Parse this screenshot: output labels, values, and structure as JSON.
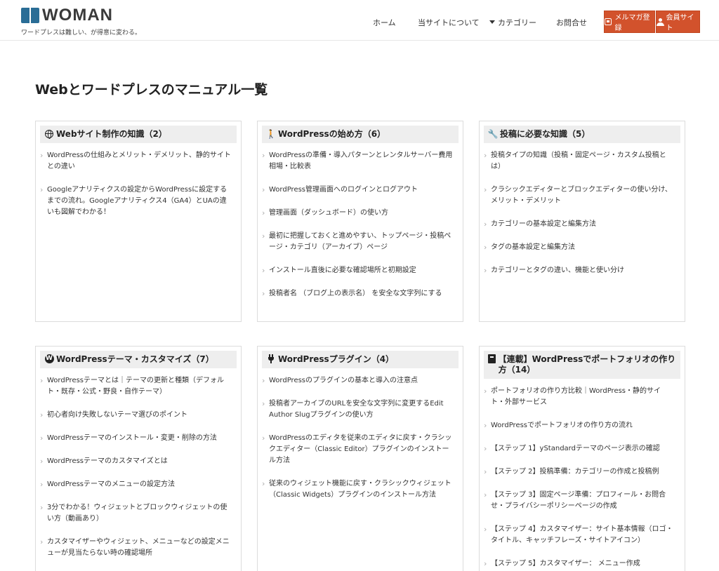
{
  "header": {
    "logo_text": "WOMAN",
    "tagline": "ワードプレスは難しい、が得意に変わる。",
    "nav": [
      {
        "label": "ホーム"
      },
      {
        "label": "当サイトについて"
      },
      {
        "label": "カテゴリー"
      },
      {
        "label": "お問合せ"
      }
    ],
    "buttons": {
      "newsletter": "メルマガ登録",
      "member": "会員サイト"
    },
    "button_color": "#d2522c"
  },
  "page": {
    "title": "Webとワードプレスのマニュアル一覧"
  },
  "cards": [
    {
      "icon": "globe-icon",
      "title": "Webサイト制作の知識（2）",
      "items": [
        "WordPressの仕組みとメリット・デメリット、静的サイトとの違い",
        "Googleアナリティクスの設定からWordPressに設定するまでの流れ。Googleアナリティクス4（GA4）とUAの違いも図解でわかる！"
      ]
    },
    {
      "icon": "walking-person-icon",
      "title": "WordPressの始め方（6）",
      "items": [
        "WordPressの準備・導入パターンとレンタルサーバー費用相場・比較表",
        "WordPress管理画面へのログインとログアウト",
        "管理画面（ダッシュボード）の使い方",
        "最初に把握しておくと進めやすい、トップページ・投稿ページ・カテゴリ（アーカイブ）ページ",
        "インストール直後に必要な確認場所と初期設定",
        "投稿者名 （ブログ上の表示名） を安全な文字列にする"
      ]
    },
    {
      "icon": "wrench-icon",
      "title": "投稿に必要な知識（5）",
      "items": [
        "投稿タイプの知識（投稿・固定ページ・カスタム投稿とは）",
        "クラシックエディターとブロックエディターの使い分け、メリット・デメリット",
        "カテゴリーの基本設定と編集方法",
        "タグの基本設定と編集方法",
        "カテゴリーとタグの違い、機能と使い分け"
      ]
    },
    {
      "icon": "wordpress-icon",
      "title": "WordPressテーマ・カスタマイズ（7）",
      "items": [
        "WordPressテーマとは｜テーマの更新と種類（デフォルト・既存・公式・野良・自作テーマ）",
        "初心者向け失敗しないテーマ選びのポイント",
        "WordPressテーマのインストール・変更・削除の方法",
        "WordPressテーマのカスタマイズとは",
        "WordPressテーマのメニューの設定方法",
        "3分でわかる！ウィジェットとブロックウィジェットの使い方（動画あり）",
        "カスタマイザーやウィジェット、メニューなどの設定メニューが見当たらない時の確認場所"
      ]
    },
    {
      "icon": "plug-icon",
      "title": "WordPressプラグイン（4）",
      "items": [
        "WordPressのプラグインの基本と導入の注意点",
        "投稿者アーカイブのURLを安全な文字列に変更するEdit Author Slugプラグインの使い方",
        "WordPressのエディタを従来のエディタに戻す・クラシックエディター（Classic Editor）プラグインのインストール方法",
        "従来のウィジェット機能に戻す・クラシックウィジェット（Classic Widgets）プラグインのインストール方法"
      ]
    },
    {
      "icon": "book-icon",
      "title": "【連載】WordPressでポートフォリオの作り方（14）",
      "items": [
        "ポートフォリオの作り方比較｜WordPress・静的サイト・外部サービス",
        "WordPressでポートフォリオの作り方の流れ",
        "【ステップ 1】yStandardテーマのページ表示の確認",
        "【ステップ 2】投稿準備：カテゴリーの作成と投稿例",
        "【ステップ 3】固定ページ準備：プロフィール・お問合せ・プライバシーポリシーページの作成",
        "【ステップ 4】カスタマイザー：サイト基本情報（ロゴ・タイトル、キャッチフレーズ・サイトアイコン）",
        "【ステップ 5】カスタマイザー： メニュー作成"
      ]
    }
  ]
}
